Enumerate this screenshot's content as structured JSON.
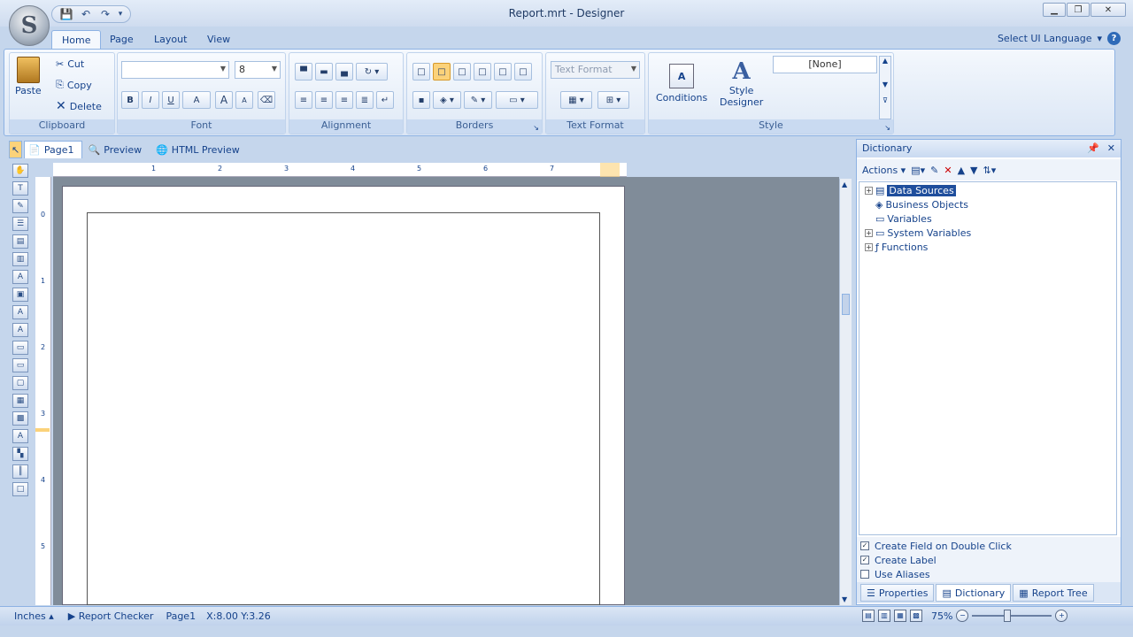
{
  "window": {
    "title": "Report.mrt - Designer"
  },
  "orb": {
    "glyph": "S"
  },
  "qat": {
    "save": "💾",
    "undo": "↶",
    "redo": "↷",
    "more": "▾"
  },
  "ribbon_tabs": [
    "Home",
    "Page",
    "Layout",
    "View"
  ],
  "ui_language": {
    "label": "Select UI Language",
    "arrow": "▾",
    "help": "?"
  },
  "clipboard": {
    "paste": "Paste",
    "cut": "Cut",
    "copy": "Copy",
    "delete": "Delete",
    "group": "Clipboard"
  },
  "font": {
    "name": "",
    "size": "8",
    "group": "Font",
    "bold": "B",
    "italic": "I",
    "underline": "U",
    "color": "A",
    "grow": "A",
    "shrink": "A"
  },
  "alignment": {
    "group": "Alignment"
  },
  "borders": {
    "group": "Borders"
  },
  "text_format": {
    "combo": "Text Format",
    "group": "Text Format"
  },
  "style": {
    "conditions": "Conditions",
    "style_designer_line1": "Style",
    "style_designer_line2": "Designer",
    "current": "[None]",
    "group": "Style"
  },
  "doc_tabs": [
    "Page1",
    "Preview",
    "HTML Preview"
  ],
  "ruler": {
    "h": [
      "1",
      "2",
      "3",
      "4",
      "5",
      "6",
      "7"
    ],
    "v": [
      "0",
      "1",
      "2",
      "3",
      "4",
      "5"
    ]
  },
  "dictionary": {
    "title": "Dictionary",
    "pin": "📌",
    "close": "✕",
    "actions": "Actions",
    "tree": [
      {
        "label": "Data Sources",
        "expander": "+",
        "selected": true
      },
      {
        "label": "Business Objects",
        "expander": ""
      },
      {
        "label": "Variables",
        "expander": ""
      },
      {
        "label": "System Variables",
        "expander": "+"
      },
      {
        "label": "Functions",
        "expander": "+"
      }
    ],
    "options": [
      {
        "label": "Create Field on Double Click",
        "checked": true
      },
      {
        "label": "Create Label",
        "checked": true
      },
      {
        "label": "Use Aliases",
        "checked": false
      }
    ],
    "tabs": [
      "Properties",
      "Dictionary",
      "Report Tree"
    ]
  },
  "status": {
    "units": "Inches",
    "checker": "Report Checker",
    "page": "Page1",
    "coords": "X:8.00  Y:3.26",
    "zoom": "75%"
  }
}
